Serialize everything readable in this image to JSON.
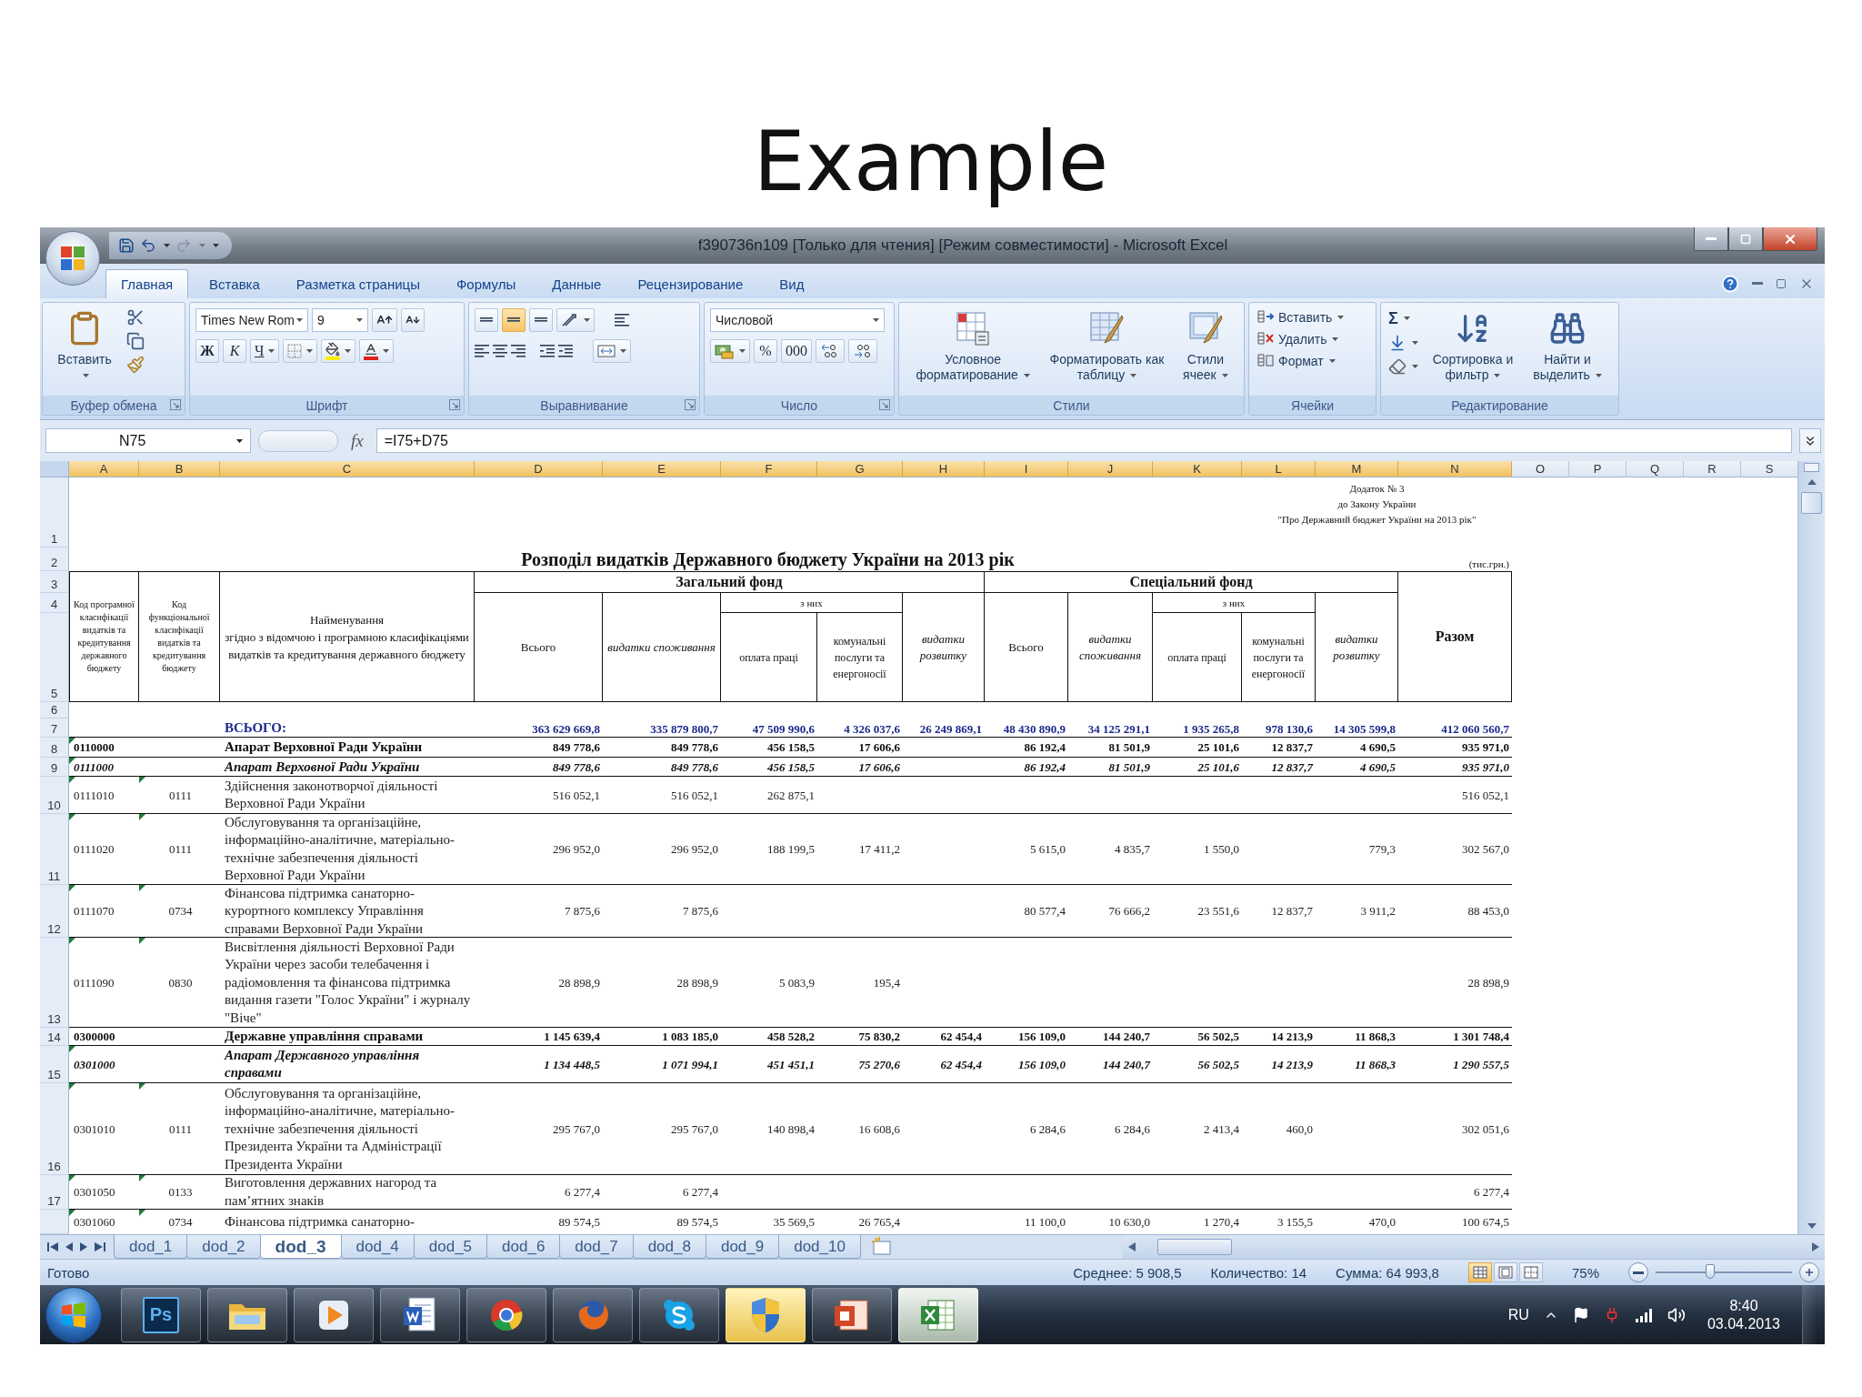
{
  "slide": {
    "title": "Example"
  },
  "window": {
    "title": "f390736n109 [Только для чтения] [Режим совместимости] - Microsoft Excel"
  },
  "tabs": [
    {
      "label": "Главная",
      "selected": true
    },
    {
      "label": "Вставка",
      "selected": false
    },
    {
      "label": "Разметка страницы",
      "selected": false
    },
    {
      "label": "Формулы",
      "selected": false
    },
    {
      "label": "Данные",
      "selected": false
    },
    {
      "label": "Рецензирование",
      "selected": false
    },
    {
      "label": "Вид",
      "selected": false
    }
  ],
  "ribbon": {
    "groups": [
      {
        "kind": "clipboard",
        "label": "Буфер обмена",
        "paste": "Вставить"
      },
      {
        "kind": "font",
        "label": "Шрифт",
        "font": "Times New Rom",
        "size": "9",
        "bold": "Ж",
        "italic": "К",
        "underline": "Ч"
      },
      {
        "kind": "alignment",
        "label": "Выравнивание",
        "valign": [
          {
            "selected": false
          },
          {
            "selected": true
          },
          {
            "selected": false
          }
        ]
      },
      {
        "kind": "number",
        "label": "Число",
        "format": "Числовой",
        "percent": "%",
        "thousands": "000"
      },
      {
        "kind": "styles",
        "label": "Стили",
        "buttons": [
          "Условное форматирование",
          "Форматировать как таблицу",
          "Стили ячеек"
        ]
      },
      {
        "kind": "cells",
        "label": "Ячейки",
        "buttons": [
          "Вставить",
          "Удалить",
          "Формат"
        ]
      },
      {
        "kind": "editing",
        "label": "Редактирование",
        "sum": "Σ",
        "buttons": [
          "Сортировка и фильтр",
          "Найти и выделить"
        ]
      }
    ]
  },
  "formula_bar": {
    "name_box": "N75",
    "function_label": "fx",
    "formula": "=I75+D75"
  },
  "columns": [
    {
      "label": "A",
      "highlighted": true
    },
    {
      "label": "B",
      "highlighted": true
    },
    {
      "label": "C",
      "highlighted": true
    },
    {
      "label": "D",
      "highlighted": true
    },
    {
      "label": "E",
      "highlighted": true
    },
    {
      "label": "F",
      "highlighted": true
    },
    {
      "label": "G",
      "highlighted": true
    },
    {
      "label": "H",
      "highlighted": true
    },
    {
      "label": "I",
      "highlighted": true
    },
    {
      "label": "J",
      "highlighted": true
    },
    {
      "label": "K",
      "highlighted": true
    },
    {
      "label": "L",
      "highlighted": true
    },
    {
      "label": "M",
      "highlighted": true
    },
    {
      "label": "N",
      "highlighted": true
    },
    {
      "label": "O",
      "highlighted": false
    },
    {
      "label": "P",
      "highlighted": false
    },
    {
      "label": "Q",
      "highlighted": false
    },
    {
      "label": "R",
      "highlighted": false
    },
    {
      "label": "S",
      "highlighted": false
    }
  ],
  "row_numbers": [
    "1",
    "2",
    "3",
    "4",
    "5",
    "6",
    "7",
    "8",
    "9",
    "10",
    "11",
    "12",
    "13",
    "14",
    "15",
    "16",
    "17"
  ],
  "notice": [
    "Додаток № 3",
    "до Закону України",
    "\"Про Державний бюджет України на 2013 рік\""
  ],
  "table_title": "Розподіл видатків Державного бюджету України на 2013 рік",
  "unit": "(тис.грн.)",
  "table_header": {
    "program_code": "Код програмної класифікації видатків та кредитування державного бюджету",
    "function_code": "Код функціональної класифікації видатків та кредитування бюджету",
    "name": "Найменування\nзгідно з відомчою і програмною класифікаціями видатків та кредитування державного бюджету",
    "funds": [
      {
        "title": "Загальний фонд",
        "total": "Всього",
        "consumption": "видатки споживання",
        "of_which": "з них",
        "wages": "оплата праці",
        "utilities": "комунальні послуги та енергоносії",
        "development": "видатки розвитку"
      },
      {
        "title": "Спеціальний фонд",
        "total": "Всього",
        "consumption": "видатки споживання",
        "of_which": "з них",
        "wages": "оплата праці",
        "utilities": "комунальні послуги та енергоносії",
        "development": "видатки розвитку"
      }
    ],
    "sum": "Разом"
  },
  "rows": [
    {
      "kind": "total",
      "marked": false,
      "name": "ВСЬОГО:",
      "values": {
        "D": "363 629 669,8",
        "E": "335 879 800,7",
        "F": "47 509 990,6",
        "G": "4 326 037,6",
        "H": "26 249 869,1",
        "I": "48 430 890,9",
        "J": "34 125 291,1",
        "K": "1 935 265,8",
        "L": "978 130,6",
        "M": "14 305 599,8",
        "N": "412 060 560,7"
      }
    },
    {
      "kind": "group",
      "marked": true,
      "code": "0110000",
      "name": "Апарат Верховної Ради України",
      "values": {
        "D": "849 778,6",
        "E": "849 778,6",
        "F": "456 158,5",
        "G": "17 606,6",
        "I": "86 192,4",
        "J": "81 501,9",
        "K": "25 101,6",
        "L": "12 837,7",
        "M": "4 690,5",
        "N": "935 971,0"
      }
    },
    {
      "kind": "subgroup",
      "marked": true,
      "code": "0111000",
      "name": "Апарат Верховної Ради України",
      "values": {
        "D": "849 778,6",
        "E": "849 778,6",
        "F": "456 158,5",
        "G": "17 606,6",
        "I": "86 192,4",
        "J": "81 501,9",
        "K": "25 101,6",
        "L": "12 837,7",
        "M": "4 690,5",
        "N": "935 971,0"
      }
    },
    {
      "kind": "item",
      "marked": true,
      "code": "0111010",
      "function_code": "0111",
      "name": "Здійснення законотворчої діяльності Верховної Ради України",
      "values": {
        "D": "516 052,1",
        "E": "516 052,1",
        "F": "262 875,1",
        "N": "516 052,1"
      }
    },
    {
      "kind": "item",
      "marked": true,
      "code": "0111020",
      "function_code": "0111",
      "name": "Обслуговування та організаційне, інформаційно-аналітичне, матеріально-технічне забезпечення діяльності Верховної Ради України",
      "values": {
        "D": "296 952,0",
        "E": "296 952,0",
        "F": "188 199,5",
        "G": "17 411,2",
        "I": "5 615,0",
        "J": "4 835,7",
        "K": "1 550,0",
        "M": "779,3",
        "N": "302 567,0"
      }
    },
    {
      "kind": "item",
      "marked": true,
      "code": "0111070",
      "function_code": "0734",
      "name": "Фінансова підтримка санаторно-курортного комплексу Управління справами Верховної Ради України",
      "values": {
        "D": "7 875,6",
        "E": "7 875,6",
        "I": "80 577,4",
        "J": "76 666,2",
        "K": "23 551,6",
        "L": "12 837,7",
        "M": "3 911,2",
        "N": "88 453,0"
      }
    },
    {
      "kind": "item",
      "marked": true,
      "code": "0111090",
      "function_code": "0830",
      "name": "Висвітлення діяльності Верховної Ради України через засоби телебачення і радіомовлення та фінансова підтримка видання газети \"Голос України\" і журналу \"Віче\"",
      "values": {
        "D": "28 898,9",
        "E": "28 898,9",
        "F": "5 083,9",
        "G": "195,4",
        "N": "28 898,9"
      }
    },
    {
      "kind": "group",
      "marked": false,
      "code": "0300000",
      "name": "Державне управління справами",
      "values": {
        "D": "1 145 639,4",
        "E": "1 083 185,0",
        "F": "458 528,2",
        "G": "75 830,2",
        "H": "62 454,4",
        "I": "156 109,0",
        "J": "144 240,7",
        "K": "56 502,5",
        "L": "14 213,9",
        "M": "11 868,3",
        "N": "1 301 748,4"
      }
    },
    {
      "kind": "subgroup",
      "marked": true,
      "code": "0301000",
      "name": "Апарат Державного управління справами",
      "values": {
        "D": "1 134 448,5",
        "E": "1 071 994,1",
        "F": "451 451,1",
        "G": "75 270,6",
        "H": "62 454,4",
        "I": "156 109,0",
        "J": "144 240,7",
        "K": "56 502,5",
        "L": "14 213,9",
        "M": "11 868,3",
        "N": "1 290 557,5"
      }
    },
    {
      "kind": "item",
      "marked": true,
      "code": "0301010",
      "function_code": "0111",
      "name": "Обслуговування та організаційне, інформаційно-аналітичне, матеріально-технічне забезпечення діяльності Президента України та Адміністрації Президента України",
      "values": {
        "D": "295 767,0",
        "E": "295 767,0",
        "F": "140 898,4",
        "G": "16 608,6",
        "I": "6 284,6",
        "J": "6 284,6",
        "K": "2 413,4",
        "L": "460,0",
        "N": "302 051,6"
      }
    },
    {
      "kind": "item",
      "marked": true,
      "code": "0301050",
      "function_code": "0133",
      "name": "Виготовлення державних нагород та пам’ятних знаків",
      "values": {
        "D": "6 277,4",
        "E": "6 277,4",
        "N": "6 277,4"
      }
    },
    {
      "kind": "item",
      "marked": true,
      "code": "0301060",
      "function_code": "0734",
      "name": "Фінансова підтримка санаторно-",
      "values": {
        "D": "89 574,5",
        "E": "89 574,5",
        "F": "35 569,5",
        "G": "26 765,4",
        "I": "11 100,0",
        "J": "10 630,0",
        "K": "1 270,4",
        "L": "3 155,5",
        "M": "470,0",
        "N": "100 674,5"
      }
    }
  ],
  "sheet_tabs": [
    {
      "label": "dod_1",
      "selected": false
    },
    {
      "label": "dod_2",
      "selected": false
    },
    {
      "label": "dod_3",
      "selected": true
    },
    {
      "label": "dod_4",
      "selected": false
    },
    {
      "label": "dod_5",
      "selected": false
    },
    {
      "label": "dod_6",
      "selected": false
    },
    {
      "label": "dod_7",
      "selected": false
    },
    {
      "label": "dod_8",
      "selected": false
    },
    {
      "label": "dod_9",
      "selected": false
    },
    {
      "label": "dod_10",
      "selected": false
    }
  ],
  "status_bar": {
    "ready": "Готово",
    "average": "Среднее: 5 908,5",
    "count": "Количество: 14",
    "sum": "Сумма: 64 993,8",
    "views": [
      {
        "selected": true
      },
      {
        "selected": false
      },
      {
        "selected": false
      }
    ],
    "zoom": "75%",
    "zoom_slider": {
      "level": 0.4
    }
  },
  "taskbar": {
    "apps": [
      {
        "kind": "photoshop",
        "label": "Ps",
        "highlighted": false,
        "selected": false
      },
      {
        "kind": "explorer",
        "highlighted": false,
        "selected": false
      },
      {
        "kind": "media",
        "highlighted": false,
        "selected": false
      },
      {
        "kind": "word",
        "highlighted": false,
        "selected": false
      },
      {
        "kind": "chrome",
        "highlighted": false,
        "selected": false
      },
      {
        "kind": "firefox",
        "highlighted": false,
        "selected": false
      },
      {
        "kind": "skype",
        "highlighted": false,
        "selected": false
      },
      {
        "kind": "security",
        "highlighted": true,
        "selected": false
      },
      {
        "kind": "slides",
        "highlighted": false,
        "selected": false
      },
      {
        "kind": "excel",
        "highlighted": false,
        "selected": true
      }
    ],
    "tray": {
      "language": "RU",
      "time": "8:40",
      "date": "03.04.2013"
    }
  }
}
